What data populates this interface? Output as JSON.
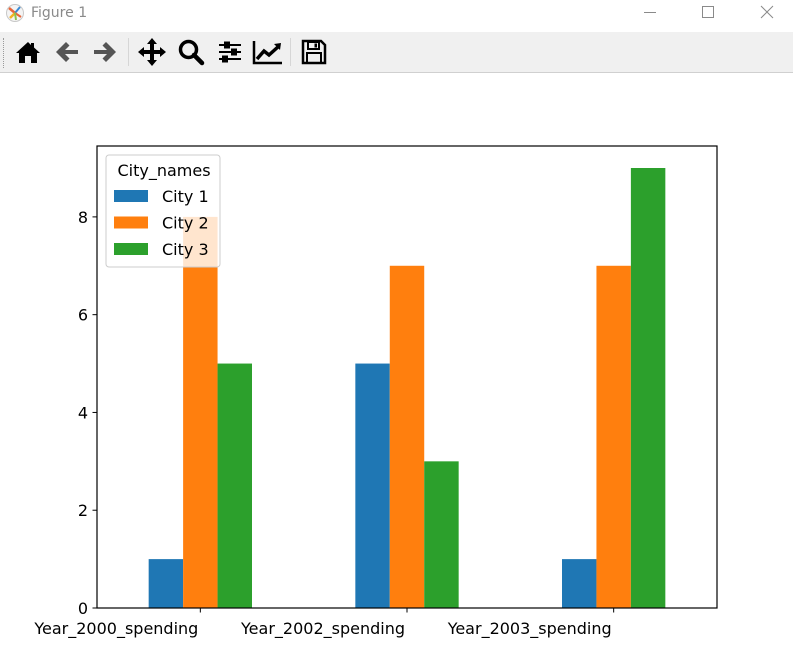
{
  "window": {
    "title": "Figure 1",
    "controls": [
      "minimize",
      "maximize",
      "close"
    ]
  },
  "toolbar": {
    "buttons": [
      {
        "name": "home",
        "icon": "home-icon",
        "enabled": true
      },
      {
        "name": "back",
        "icon": "arrow-left-icon",
        "enabled": false
      },
      {
        "name": "forward",
        "icon": "arrow-right-icon",
        "enabled": false
      },
      {
        "name": "pan",
        "icon": "move-icon",
        "enabled": true
      },
      {
        "name": "zoom",
        "icon": "zoom-icon",
        "enabled": true
      },
      {
        "name": "subplots",
        "icon": "sliders-icon",
        "enabled": true
      },
      {
        "name": "edit-axis",
        "icon": "line-chart-icon",
        "enabled": true
      },
      {
        "name": "save",
        "icon": "save-icon",
        "enabled": true
      }
    ]
  },
  "colors": {
    "City 1": "#1f77b4",
    "City 2": "#ff7f0e",
    "City 3": "#2ca02c"
  },
  "chart_data": {
    "type": "bar",
    "title": "",
    "categories": [
      "Year_2000_spending",
      "Year_2002_spending",
      "Year_2003_spending"
    ],
    "series": [
      {
        "name": "City 1",
        "values": [
          1,
          5,
          1
        ]
      },
      {
        "name": "City 2",
        "values": [
          8,
          7,
          7
        ]
      },
      {
        "name": "City 3",
        "values": [
          5,
          3,
          9
        ]
      }
    ],
    "xlabel": "",
    "ylabel": "",
    "ylim": [
      0,
      9.45
    ],
    "yticks": [
      0,
      2,
      4,
      6,
      8
    ],
    "legend": {
      "title": "City_names",
      "placement": "upper-left"
    },
    "grid": false
  }
}
